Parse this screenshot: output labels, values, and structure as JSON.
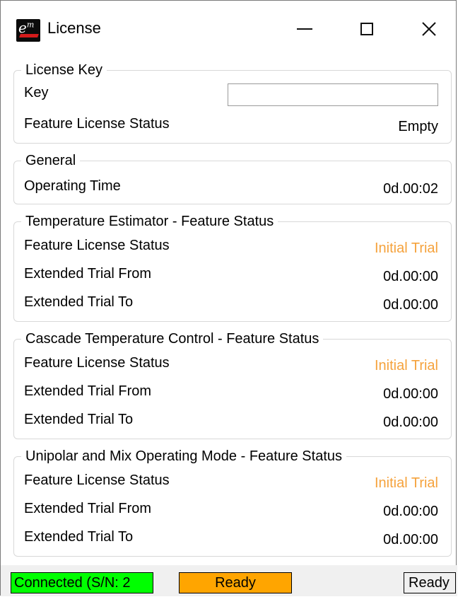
{
  "window": {
    "title": "License",
    "icon": "em-app-icon"
  },
  "titlebar_buttons": {
    "minimize_icon": "minimize-icon",
    "maximize_icon": "maximize-icon",
    "close_icon": "close-icon",
    "close_glyph": "✕"
  },
  "license_key": {
    "legend": "License Key",
    "key_label": "Key",
    "key_value": "",
    "status_label": "Feature License Status",
    "status_value": "Empty"
  },
  "general": {
    "legend": "General",
    "operating_time_label": "Operating Time",
    "operating_time_value": "0d.00:02"
  },
  "features": [
    {
      "legend": "Temperature Estimator - Feature Status",
      "status_label": "Feature License Status",
      "status_value": "Initial Trial",
      "from_label": "Extended Trial From",
      "from_value": "0d.00:00",
      "to_label": "Extended Trial To",
      "to_value": "0d.00:00"
    },
    {
      "legend": "Cascade Temperature Control - Feature Status",
      "status_label": "Feature License Status",
      "status_value": "Initial Trial",
      "from_label": "Extended Trial From",
      "from_value": "0d.00:00",
      "to_label": "Extended Trial To",
      "to_value": "0d.00:00"
    },
    {
      "legend": "Unipolar and Mix Operating Mode - Feature Status",
      "status_label": "Feature License Status",
      "status_value": "Initial Trial",
      "from_label": "Extended Trial From",
      "from_value": "0d.00:00",
      "to_label": "Extended Trial To",
      "to_value": "0d.00:00"
    }
  ],
  "statusbar": {
    "connected": "Connected (S/N: 2",
    "ready_orange": "Ready",
    "ready_plain": "Ready"
  },
  "colors": {
    "trial": "#f5a23c",
    "connected_bg": "#00ff00",
    "ready_bg": "#ffa500"
  }
}
